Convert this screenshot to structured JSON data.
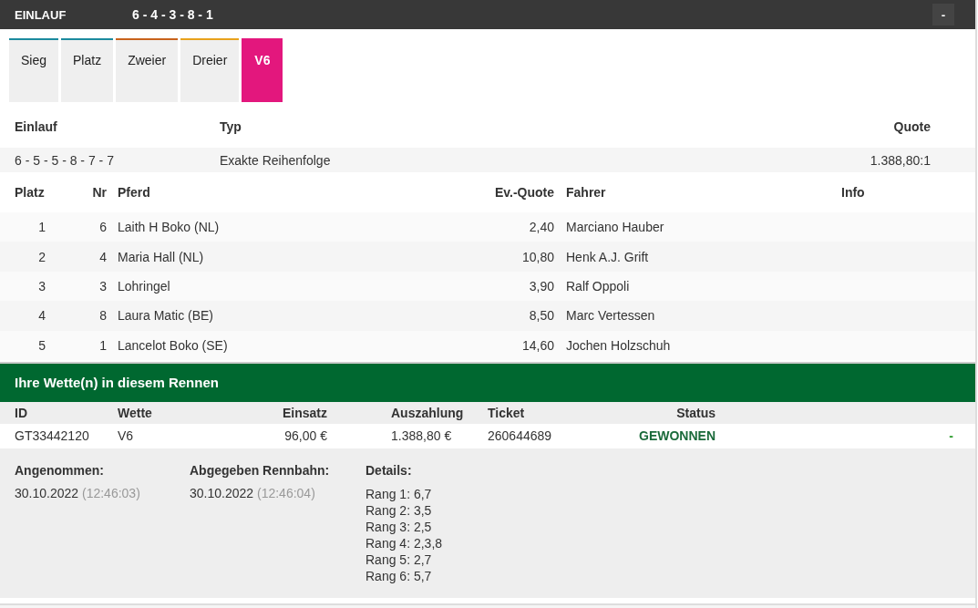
{
  "header": {
    "title": "EINLAUF",
    "result": "6 - 4 - 3 - 8 - 1",
    "collapse": "-"
  },
  "tabs": [
    {
      "label": "Sieg",
      "selected": false,
      "color": "#1b8a9e"
    },
    {
      "label": "Platz",
      "selected": false,
      "color": "#1b8a9e"
    },
    {
      "label": "Zweier",
      "selected": false,
      "color": "#c8621c"
    },
    {
      "label": "Dreier",
      "selected": false,
      "color": "#e8a21c"
    },
    {
      "label": "V6",
      "selected": true,
      "color": "#e3177d"
    }
  ],
  "einlauf_table": {
    "columns": [
      "Einlauf",
      "Typ",
      "Quote"
    ],
    "row": [
      "6 - 5 - 5 - 8 - 7 - 7",
      "Exakte Reihenfolge",
      "1.388,80:1"
    ]
  },
  "runners": {
    "columns": [
      "Platz",
      "Nr",
      "Pferd",
      "Ev.-Quote",
      "Fahrer",
      "Info"
    ],
    "rows": [
      [
        "1",
        "6",
        "Laith H Boko (NL)",
        "2,40",
        "Marciano Hauber"
      ],
      [
        "2",
        "4",
        "Maria Hall (NL)",
        "10,80",
        "Henk A.J. Grift"
      ],
      [
        "3",
        "3",
        "Lohringel",
        "3,90",
        "Ralf Oppoli"
      ],
      [
        "4",
        "8",
        "Laura Matic (BE)",
        "8,50",
        "Marc Vertessen"
      ],
      [
        "5",
        "1",
        "Lancelot Boko (SE)",
        "14,60",
        "Jochen Holzschuh"
      ]
    ]
  },
  "bets": {
    "title": "Ihre Wette(n) in diesem Rennen",
    "columns": [
      "ID",
      "Wette",
      "Einsatz",
      "Auszahlung",
      "Ticket",
      "Status"
    ],
    "row": {
      "id": "GT33442120",
      "wette": "V6",
      "einsatz": "96,00 €",
      "auszahlung": "1.388,80 €",
      "ticket": "260644689",
      "status": "GEWONNEN",
      "toggle": "-"
    },
    "details": [
      {
        "label": "Angenommen:",
        "date": "30.10.2022",
        "time": "(12:46:03)"
      },
      {
        "label": "Abgegeben Rennbahn:",
        "date": "30.10.2022",
        "time": "(12:46:04)"
      }
    ],
    "details_label": "Details:",
    "ranks": [
      "Rang 1: 6,7",
      "Rang 2: 3,5",
      "Rang 3: 2,5",
      "Rang 4: 2,3,8",
      "Rang 5: 2,7",
      "Rang 6: 5,7"
    ]
  }
}
